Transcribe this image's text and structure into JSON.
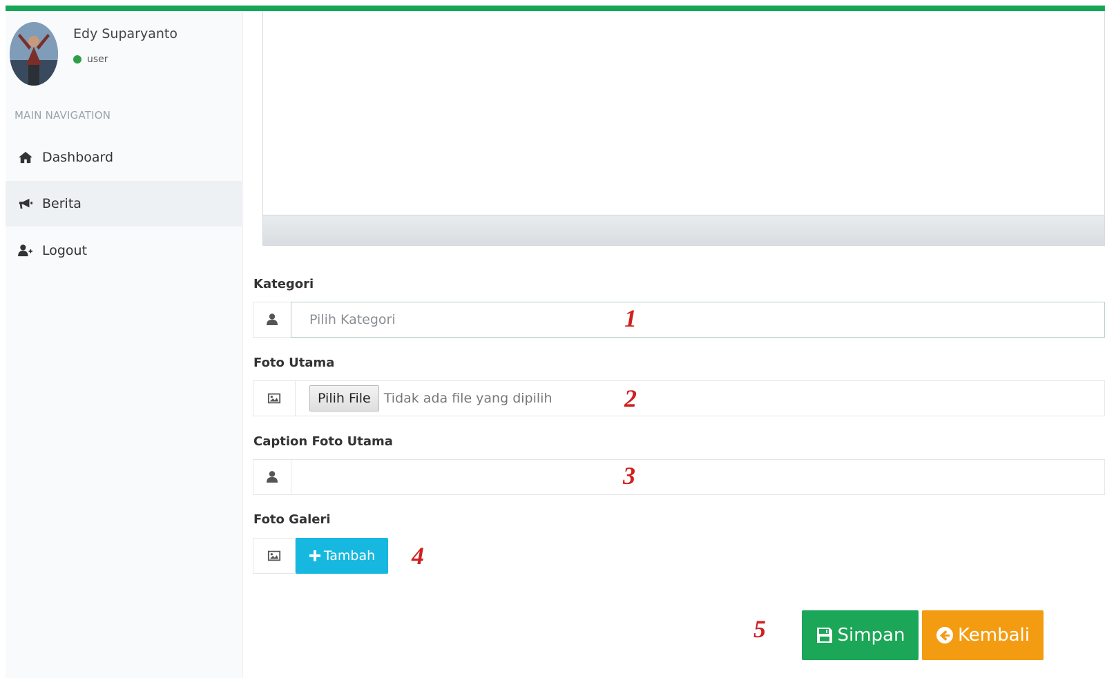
{
  "user": {
    "name": "Edy Suparyanto",
    "status": "user"
  },
  "nav": {
    "header": "MAIN NAVIGATION",
    "items": [
      {
        "label": "Dashboard",
        "icon": "home-icon",
        "active": false
      },
      {
        "label": "Berita",
        "icon": "bullhorn-icon",
        "active": true
      },
      {
        "label": "Logout",
        "icon": "user-plus-icon",
        "active": false
      }
    ]
  },
  "form": {
    "kategori": {
      "label": "Kategori",
      "placeholder": "Pilih Kategori",
      "icon": "user-icon"
    },
    "foto_utama": {
      "label": "Foto Utama",
      "button": "Pilih File",
      "file_text": "Tidak ada file yang dipilih",
      "icon": "picture-icon"
    },
    "caption": {
      "label": "Caption Foto Utama",
      "value": "",
      "icon": "user-icon"
    },
    "foto_galeri": {
      "label": "Foto Galeri",
      "add_button": "Tambah",
      "icon": "picture-icon"
    }
  },
  "actions": {
    "save": "Simpan",
    "back": "Kembali"
  },
  "markers": [
    "1",
    "2",
    "3",
    "4",
    "5"
  ],
  "colors": {
    "topbar": "#17a558",
    "save": "#1ba757",
    "back": "#f39c12",
    "add": "#16b8e0",
    "marker": "#d01f1f",
    "status_online": "#2e9f46"
  }
}
